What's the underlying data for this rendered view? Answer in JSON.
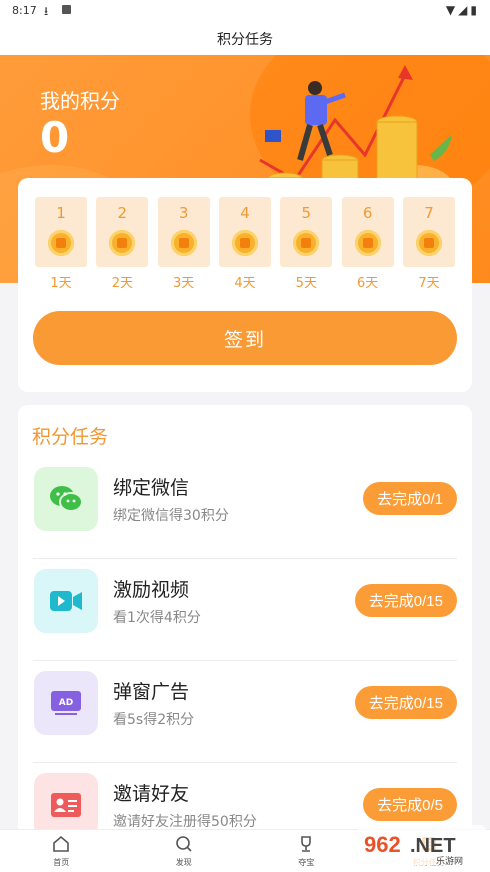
{
  "status_bar": {
    "time": "8:17"
  },
  "title_bar": {
    "title": "积分任务"
  },
  "points": {
    "label": "我的积分",
    "value": "0"
  },
  "checkin": {
    "days": [
      {
        "num": "1",
        "label": "1天"
      },
      {
        "num": "2",
        "label": "2天"
      },
      {
        "num": "3",
        "label": "3天"
      },
      {
        "num": "4",
        "label": "4天"
      },
      {
        "num": "5",
        "label": "5天"
      },
      {
        "num": "6",
        "label": "6天"
      },
      {
        "num": "7",
        "label": "7天"
      }
    ],
    "button": "签到"
  },
  "tasks": {
    "title": "积分任务",
    "items": [
      {
        "name": "绑定微信",
        "desc": "绑定微信得30积分",
        "action": "去完成0/1",
        "icon": "wechat-icon",
        "bg": "#dcf7dc",
        "color": "#3fbf48"
      },
      {
        "name": "激励视频",
        "desc": "看1次得4积分",
        "action": "去完成0/15",
        "icon": "video-icon",
        "bg": "#d9f6f8",
        "color": "#1fb8cc"
      },
      {
        "name": "弹窗广告",
        "desc": "看5s得2积分",
        "action": "去完成0/15",
        "icon": "ad-icon",
        "bg": "#ece6fb",
        "color": "#8560e0"
      },
      {
        "name": "邀请好友",
        "desc": "邀请好友注册得50积分",
        "action": "去完成0/5",
        "icon": "invite-icon",
        "bg": "#fde3e3",
        "color": "#ee5b5b"
      }
    ]
  },
  "tabbar": {
    "items": [
      {
        "label": "首页",
        "icon": "home-icon"
      },
      {
        "label": "发现",
        "icon": "discover-icon"
      },
      {
        "label": "夺宝",
        "icon": "trophy-icon"
      },
      {
        "label": "积分任务",
        "icon": "task-list-icon"
      }
    ]
  },
  "watermark": {
    "text": "962.NET",
    "sub": "乐游网"
  },
  "colors": {
    "accent": "#fb9c37",
    "banner": "#ff8c20"
  }
}
